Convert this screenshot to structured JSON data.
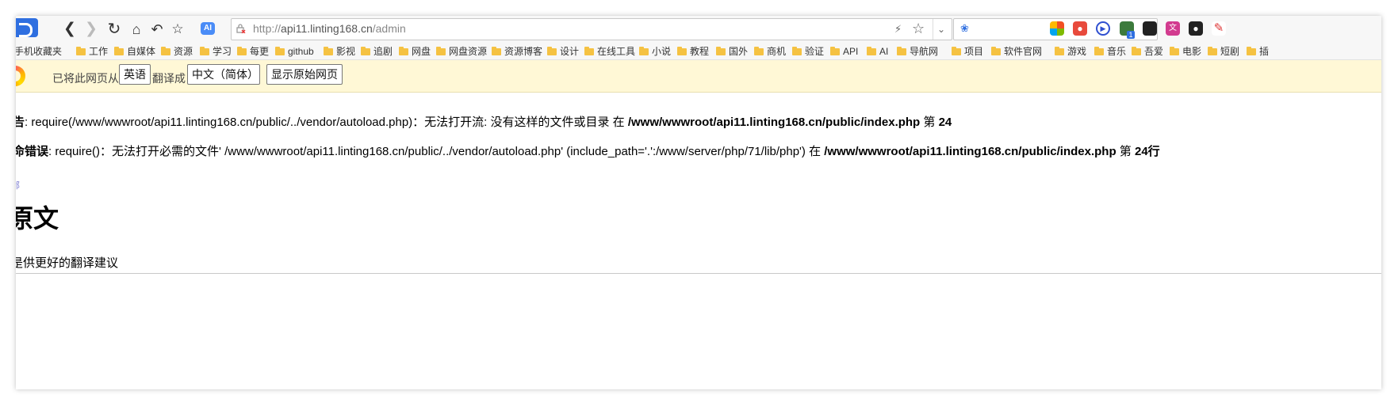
{
  "browser": {
    "url_proto": "http://",
    "url_host": "api11.linting168.cn",
    "url_path": "/admin",
    "ai_label": "AI",
    "ext_badge": "1"
  },
  "bookmarks": [
    {
      "label": "手机收藏夹",
      "folder": false
    },
    {
      "label": "工作",
      "folder": true
    },
    {
      "label": "自媒体",
      "folder": true
    },
    {
      "label": "资源",
      "folder": true
    },
    {
      "label": "学习",
      "folder": true
    },
    {
      "label": "每更",
      "folder": true
    },
    {
      "label": "github",
      "folder": true
    },
    {
      "label": "影视",
      "folder": true
    },
    {
      "label": "追剧",
      "folder": true
    },
    {
      "label": "网盘",
      "folder": true
    },
    {
      "label": "网盘资源",
      "folder": true
    },
    {
      "label": "资源博客",
      "folder": true
    },
    {
      "label": "设计",
      "folder": true
    },
    {
      "label": "在线工具",
      "folder": true
    },
    {
      "label": "小说",
      "folder": true
    },
    {
      "label": "教程",
      "folder": true
    },
    {
      "label": "国外",
      "folder": true
    },
    {
      "label": "商机",
      "folder": true
    },
    {
      "label": "验证",
      "folder": true
    },
    {
      "label": "API",
      "folder": true
    },
    {
      "label": "AI",
      "folder": true
    },
    {
      "label": "导航网",
      "folder": true
    },
    {
      "label": "项目",
      "folder": true
    },
    {
      "label": "软件官网",
      "folder": true
    },
    {
      "label": "游戏",
      "folder": true
    },
    {
      "label": "音乐",
      "folder": true
    },
    {
      "label": "吾爱",
      "folder": true
    },
    {
      "label": "电影",
      "folder": true
    },
    {
      "label": "短剧",
      "folder": true
    },
    {
      "label": "插",
      "folder": true
    }
  ],
  "translate_bar": {
    "prefix": "已将此网页从",
    "from_lang": "英语",
    "middle": "翻译成",
    "to_lang": "中文（简体）",
    "show_original": "显示原始网页"
  },
  "page": {
    "warning_label": "告",
    "warning_text": ":  require(/www/wwwroot/api11.linting168.cn/public/../vendor/autoload.php)：无法打开流: 没有这样的文件或目录 在 ",
    "warning_file": "/www/wwwroot/api11.linting168.cn/public/index.php",
    "warning_line_word": " 第 ",
    "warning_line": "24",
    "fatal_label": "命错误",
    "fatal_text": ":  require()：无法打开必需的文件' /www/wwwroot/api11.linting168.cn/public/../vendor/autoload.php' (include_path='.':/www/server/php/71/lib/php') 在 ",
    "fatal_file": "/www/wwwroot/api11.linting168.cn/public/index.php",
    "fatal_line_word": " 第 ",
    "fatal_line": "24行",
    "small_link": "邻",
    "heading": "原文",
    "hint": "是供更好的翻译建议"
  },
  "colors": {
    "accent": "#2f6fe0",
    "translate_bg": "#fff8d6"
  }
}
